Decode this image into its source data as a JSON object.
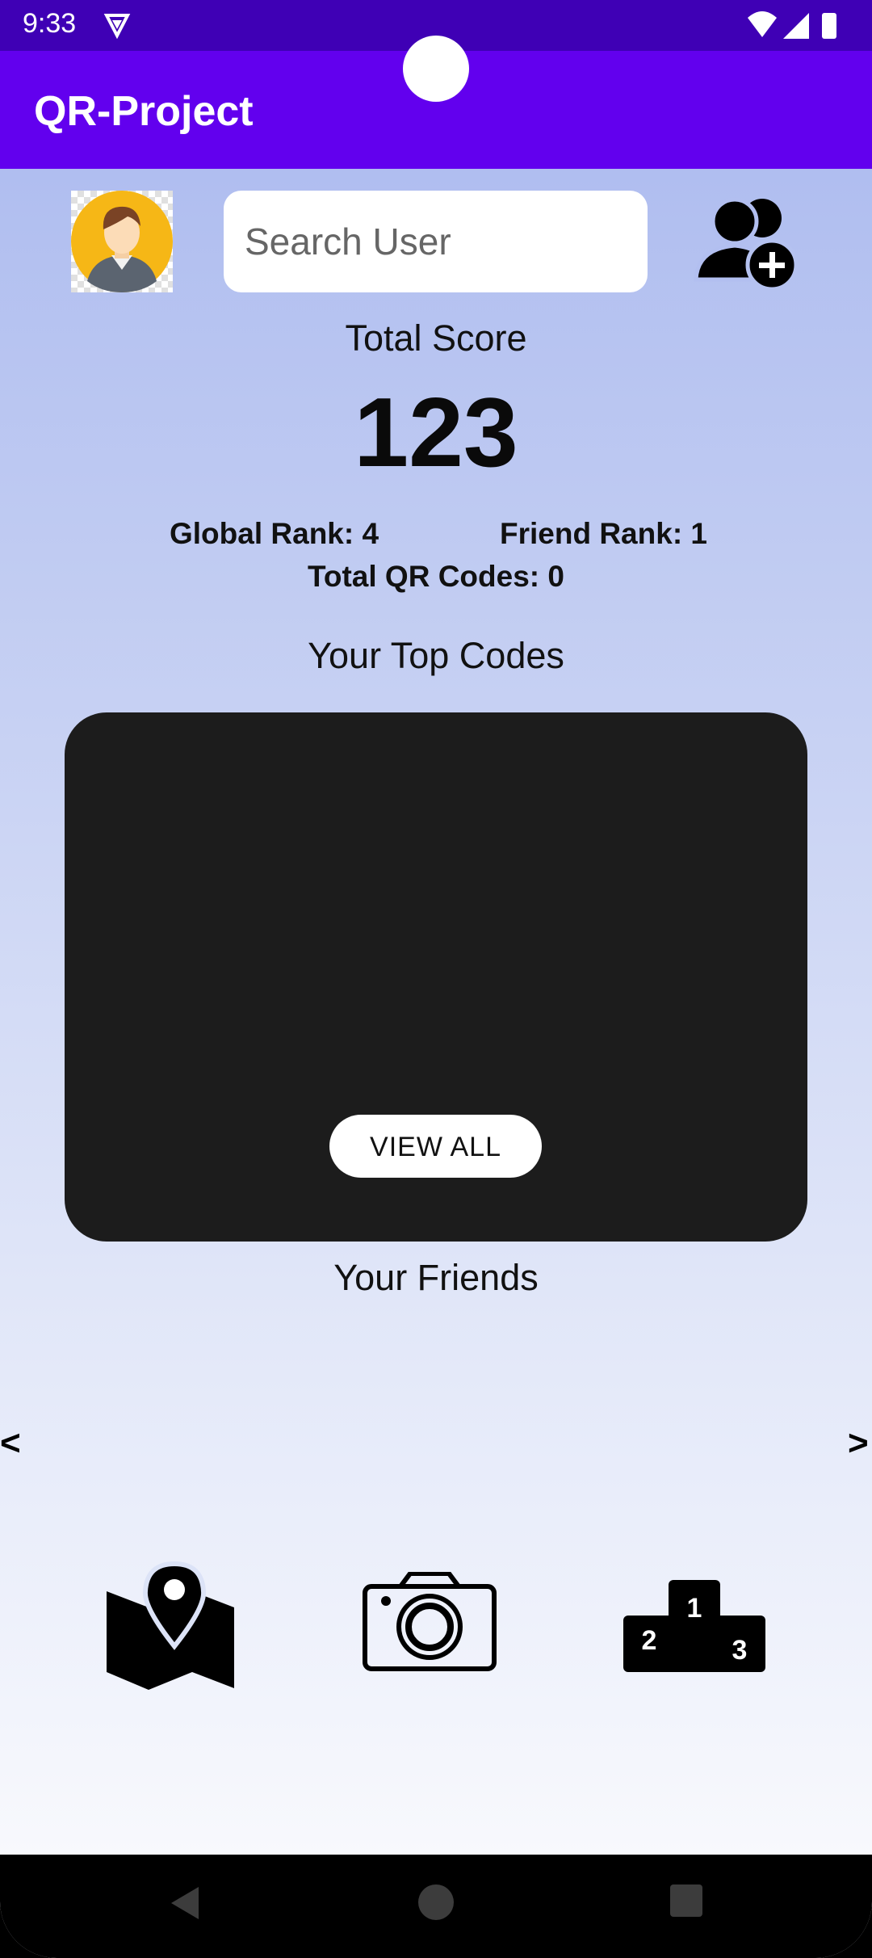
{
  "status_bar": {
    "time": "9:33"
  },
  "app_bar": {
    "title": "QR-Project"
  },
  "search": {
    "placeholder": "Search User",
    "value": ""
  },
  "score": {
    "label": "Total Score",
    "value": "123"
  },
  "ranks": {
    "global": "Global Rank: 4",
    "friend": "Friend Rank: 1",
    "total_codes": "Total QR Codes: 0"
  },
  "top_codes": {
    "title": "Your Top Codes",
    "view_all_label": "VIEW ALL"
  },
  "friends": {
    "title": "Your Friends",
    "prev": "<",
    "next": ">"
  },
  "bottom_nav": {
    "items": [
      {
        "icon": "map-pin-icon"
      },
      {
        "icon": "camera-icon"
      },
      {
        "icon": "leaderboard-podium-icon",
        "podium": [
          "1",
          "2",
          "3"
        ]
      }
    ]
  },
  "colors": {
    "status_bar": "#3f00b5",
    "app_bar": "#6200ee",
    "card": "#1c1c1c"
  }
}
